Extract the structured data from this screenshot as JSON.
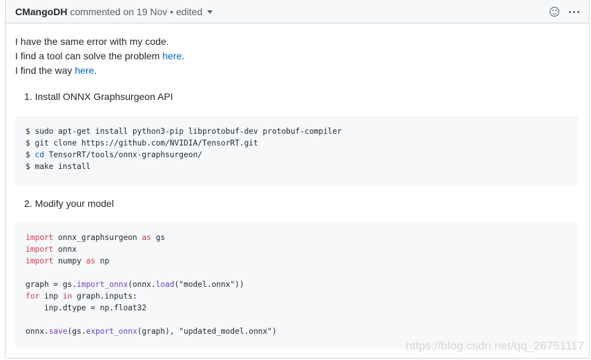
{
  "header": {
    "author": "CMangoDH",
    "meta": "commented on 19 Nov • edited"
  },
  "body": {
    "line1": "I have the same error with my code.",
    "line2_prefix": "I find a tool can solve the problem ",
    "line2_link": "here",
    "line2_suffix": ".",
    "line3_prefix": "I find the way ",
    "line3_link": "here",
    "line3_suffix": ".",
    "step1": "1. Install ONNX Graphsurgeon API",
    "step2": "2. Modify your model"
  },
  "code1": {
    "l1": "$ sudo apt-get install python3-pip libprotobuf-dev protobuf-compiler",
    "l2": "$ git clone https://github.com/NVIDIA/TensorRT.git",
    "l3a": "$ ",
    "l3b": "cd",
    "l3c": " TensorRT/tools/onnx-graphsurgeon/",
    "l4": "$ make install"
  },
  "code2": {
    "import": "import",
    "as": "as",
    "for": "for",
    "in": "in",
    "m1": " onnx_graphsurgeon ",
    "m1b": " gs",
    "m2": " onnx",
    "m3": " numpy ",
    "m3b": " np",
    "g1": "graph = gs.",
    "g2": "import_onnx",
    "g3": "(onnx.",
    "g4": "load",
    "g5": "(\"model.onnx\"))",
    "f1": " inp ",
    "f2": " graph.inputs:",
    "d1": "    inp.dtype = np.float32",
    "s1": "onnx.",
    "s2": "save",
    "s3": "(gs.",
    "s4": "export_onnx",
    "s5": "(graph), \"updated_model.onnx\")"
  },
  "watermark": "https://blog.csdn.net/qq_26751117"
}
